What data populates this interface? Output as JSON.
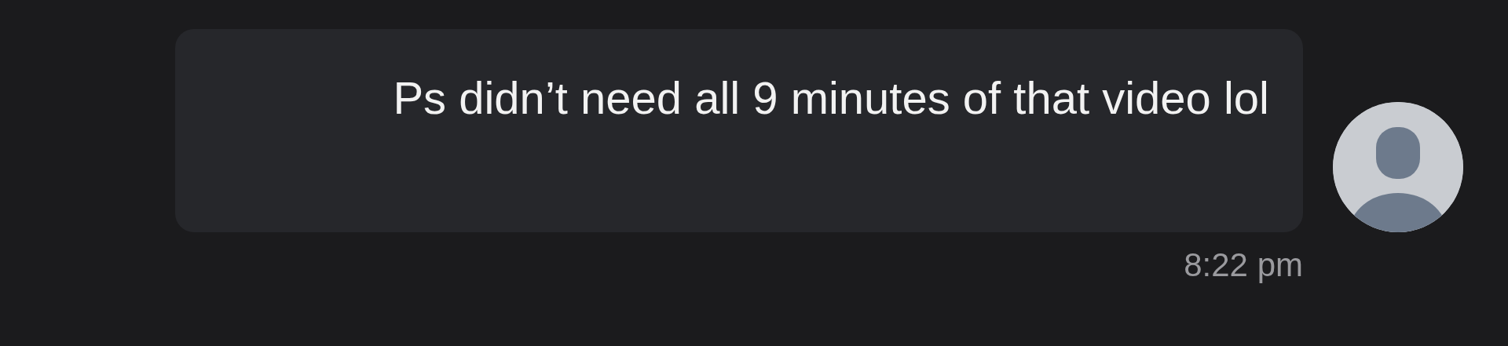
{
  "message": {
    "text": "Ps didn’t need all 9 minutes of that video lol",
    "time": "8:22 pm"
  }
}
